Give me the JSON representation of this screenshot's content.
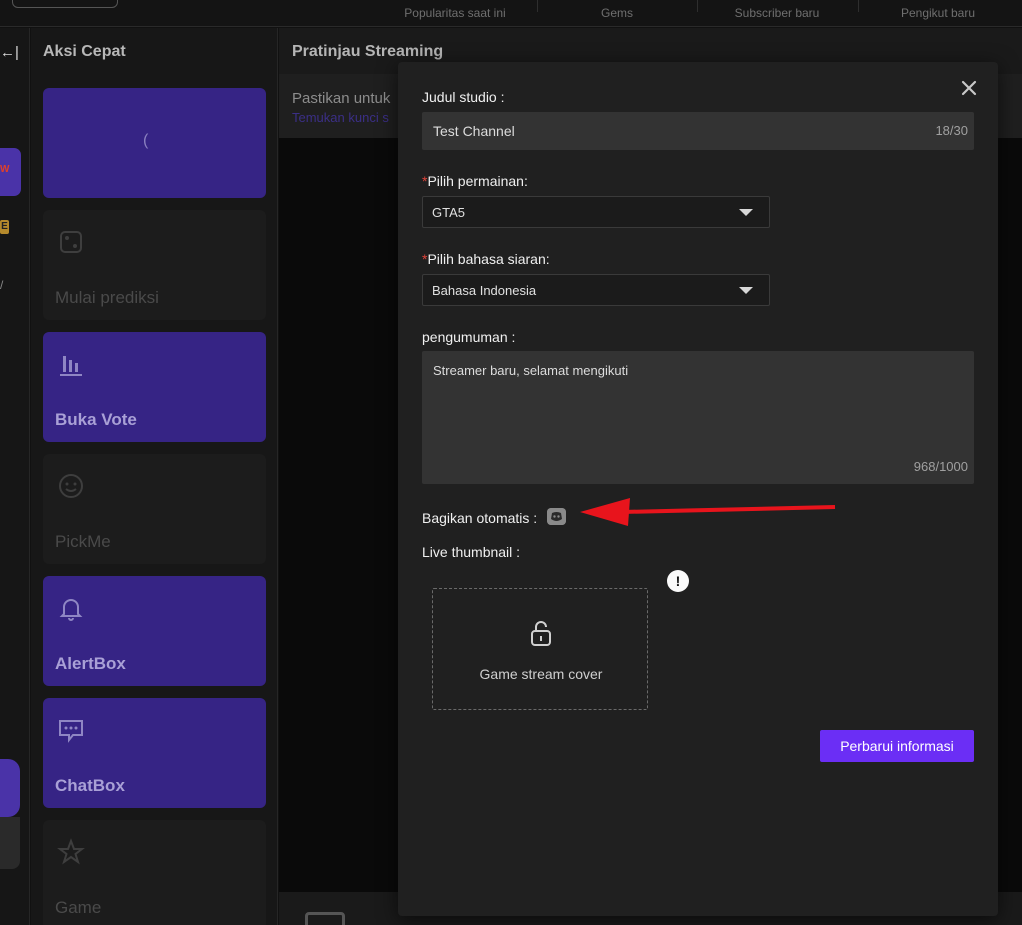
{
  "topbar": {
    "stats": [
      "Popularitas saat ini",
      "Gems",
      "Subscriber baru",
      "Pengikut baru"
    ]
  },
  "left_strip": {
    "top_glyph": "←|",
    "badge_new": "W",
    "badge_e": "E",
    "dash": "/"
  },
  "quick_actions": {
    "title": "Aksi Cepat",
    "cards": [
      {
        "label": "(",
        "style": "purple",
        "icon": "loading-icon"
      },
      {
        "label": "Mulai prediksi",
        "style": "dim",
        "icon": "dice-icon"
      },
      {
        "label": "Buka Vote",
        "style": "purple",
        "icon": "bar-chart-icon"
      },
      {
        "label": "PickMe",
        "style": "dim",
        "icon": "smile-icon"
      },
      {
        "label": "AlertBox",
        "style": "purple",
        "icon": "bell-icon"
      },
      {
        "label": "ChatBox",
        "style": "purple",
        "icon": "chat-icon"
      },
      {
        "label": "Game",
        "style": "dim",
        "icon": "star-icon"
      }
    ]
  },
  "preview": {
    "title": "Pratinjau Streaming",
    "info_line": "Pastikan untuk",
    "info_link": "Temukan kunci s"
  },
  "modal": {
    "studio_title_label": "Judul studio :",
    "studio_title_value": "Test Channel",
    "studio_title_count": "18/30",
    "game_label": "Pilih permainan:",
    "game_value": "GTA5",
    "language_label": "Pilih bahasa siaran:",
    "language_value": "Bahasa Indonesia",
    "announcement_label": "pengumuman :",
    "announcement_value": "Streamer baru, selamat mengikuti",
    "announcement_count": "968/1000",
    "auto_share_label": "Bagikan otomatis :",
    "thumbnail_label": "Live thumbnail :",
    "thumbnail_caption": "Game stream cover",
    "warning_glyph": "!",
    "submit_label": "Perbarui informasi",
    "required_mark": "*"
  },
  "colors": {
    "accent": "#6b2ef5",
    "card_purple": "#362485",
    "arrow": "#e8141c"
  }
}
